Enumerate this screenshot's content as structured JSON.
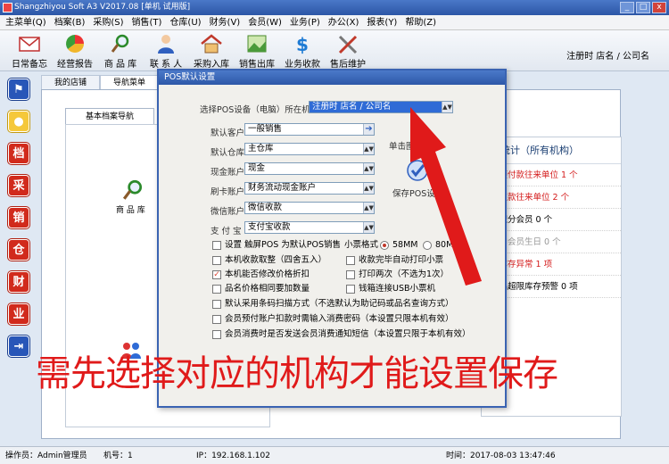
{
  "window": {
    "title": "Shangzhiyou Soft A3 V2017.08 [单机 试用版]",
    "min": "_",
    "max": "□",
    "close": "x"
  },
  "menu": [
    "主菜单(Q)",
    "档案(B)",
    "采购(S)",
    "销售(T)",
    "仓库(U)",
    "财务(V)",
    "会员(W)",
    "业务(P)",
    "办公(X)",
    "报表(Y)",
    "帮助(Z)"
  ],
  "toolbar": {
    "items": [
      "日常备忘",
      "经营报告",
      "商 品 库",
      "联 系 人",
      "采购入库",
      "销售出库",
      "业务收款",
      "售后维护"
    ],
    "right": "注册时 店名 / 公司名"
  },
  "sidebar": {
    "glyphs": [
      "档",
      "采",
      "销",
      "仓",
      "财",
      "业"
    ]
  },
  "tabs": [
    "我的店铺",
    "导航菜单"
  ],
  "main": {
    "subtab": "基本档案导航",
    "nav_product": "商 品 库"
  },
  "stats": {
    "title": "据统计（所有机构）",
    "rows": [
      "有预付款往来单位 1 个",
      "有欠款往来单位 2 个",
      "有积分会员 0 个",
      "天内会员生日 0 个",
      "品库存异常 1 项",
      "最品超限库存预警 0 项"
    ]
  },
  "dialog": {
    "title": "POS默认设置",
    "org_label": "选择POS设备（电脑）所在机构",
    "org_value": "注册时 店名 / 公司名",
    "fields": [
      {
        "label": "默认客户",
        "value": "一般销售"
      },
      {
        "label": "默认仓库",
        "value": "主仓库"
      },
      {
        "label": "现金账户",
        "value": "现金"
      },
      {
        "label": "刷卡账户",
        "value": "财务流动现金账户"
      },
      {
        "label": "微信账户",
        "value": "微信收款"
      },
      {
        "label": "支 付 宝",
        "value": "支付宝收款"
      }
    ],
    "hint": "单击图标保存",
    "save": "保存POS设置",
    "touch": "设置 触屏POS 为默认POS销售",
    "ticket_label": "小票格式",
    "ticket_58": "58MM",
    "ticket_80": "80MM",
    "opts_left": [
      "本机收款取整（四舍五入）",
      "本机能否修改价格折扣",
      "品名价格相同要加数量"
    ],
    "opts_right": [
      "收款完毕自动打印小票",
      "打印两次（不选为1次）",
      "钱箱连接USB小票机"
    ],
    "opts_full": [
      "默认采用条码扫描方式（不选默认为助记码或品名查询方式）",
      "会员预付账户扣款时需输入消费密码（本设置只限本机有效）",
      "会员消费时是否发送会员消费通知短信（本设置只限于本机有效）"
    ],
    "checked_left": [
      false,
      true,
      false
    ]
  },
  "caption": "需先选择对应的机构才能设置保存",
  "status": {
    "operator": "操作员：Admin管理员",
    "machine": "机号：1",
    "ip": "IP：192.168.1.102",
    "time": "时间：2017-08-03 13:47:46"
  },
  "colors": {
    "caption": "#e01a1a",
    "title": "#2d58a8",
    "arrow": "#e01a1a"
  }
}
